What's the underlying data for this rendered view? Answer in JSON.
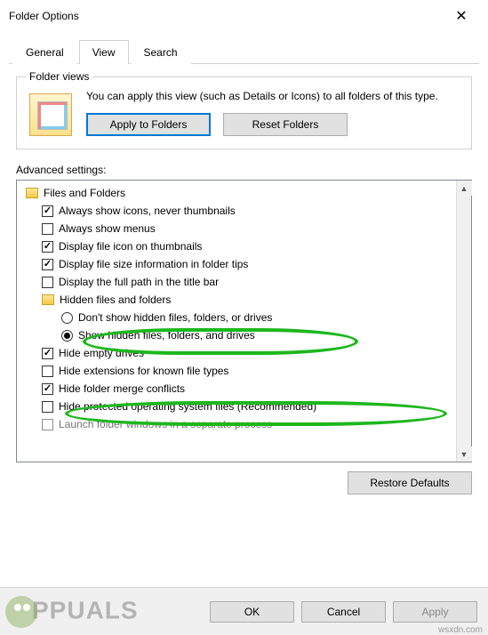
{
  "window": {
    "title": "Folder Options"
  },
  "tabs": {
    "general": "General",
    "view": "View",
    "search": "Search",
    "active": "view"
  },
  "folderViews": {
    "legend": "Folder views",
    "desc": "You can apply this view (such as Details or Icons) to all folders of this type.",
    "applyBtn": "Apply to Folders",
    "resetBtn": "Reset Folders"
  },
  "advanced": {
    "label": "Advanced settings:",
    "root": "Files and Folders",
    "items": [
      {
        "checked": true,
        "label": "Always show icons, never thumbnails"
      },
      {
        "checked": false,
        "label": "Always show menus"
      },
      {
        "checked": true,
        "label": "Display file icon on thumbnails"
      },
      {
        "checked": true,
        "label": "Display file size information in folder tips"
      },
      {
        "checked": false,
        "label": "Display the full path in the title bar"
      }
    ],
    "hiddenGroup": "Hidden files and folders",
    "radio1": "Don't show hidden files, folders, or drives",
    "radio2": "Show hidden files, folders, and drives",
    "items2": [
      {
        "checked": true,
        "label": "Hide empty drives"
      },
      {
        "checked": false,
        "label": "Hide extensions for known file types"
      },
      {
        "checked": true,
        "label": "Hide folder merge conflicts"
      },
      {
        "checked": false,
        "label": "Hide protected operating system files (Recommended)"
      }
    ],
    "cutoff": "Launch folder windows in a separate process"
  },
  "buttons": {
    "restore": "Restore Defaults",
    "ok": "OK",
    "cancel": "Cancel",
    "apply": "Apply"
  },
  "watermark": "PPUALS",
  "wsx": "wsxdn.com"
}
